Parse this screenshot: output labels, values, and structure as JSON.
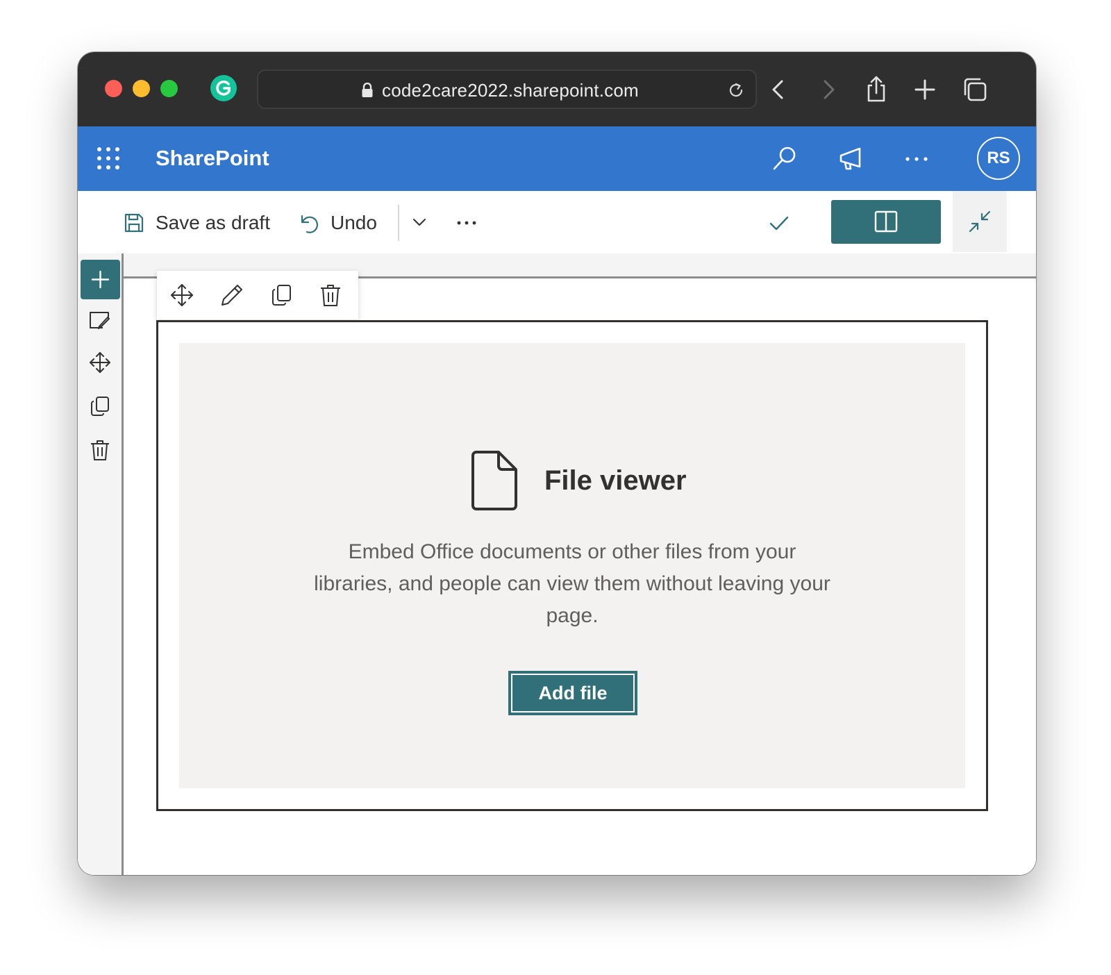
{
  "browser": {
    "url": "code2care2022.sharepoint.com",
    "icons": [
      "grammarly-icon",
      "lock-icon",
      "reload-icon",
      "back-icon",
      "forward-icon",
      "share-icon",
      "new-tab-icon",
      "tabs-overview-icon"
    ]
  },
  "suite_bar": {
    "app_name": "SharePoint",
    "avatar_initials": "RS",
    "color": "#3276cd"
  },
  "command_bar": {
    "save_label": "Save as draft",
    "undo_label": "Undo"
  },
  "webpart": {
    "title": "File viewer",
    "description": "Embed Office documents or other files from your libraries, and people can view them without leaving your page.",
    "button_label": "Add file"
  },
  "colors": {
    "accent": "#317078",
    "placeholder_bg": "#f3f2f1"
  }
}
